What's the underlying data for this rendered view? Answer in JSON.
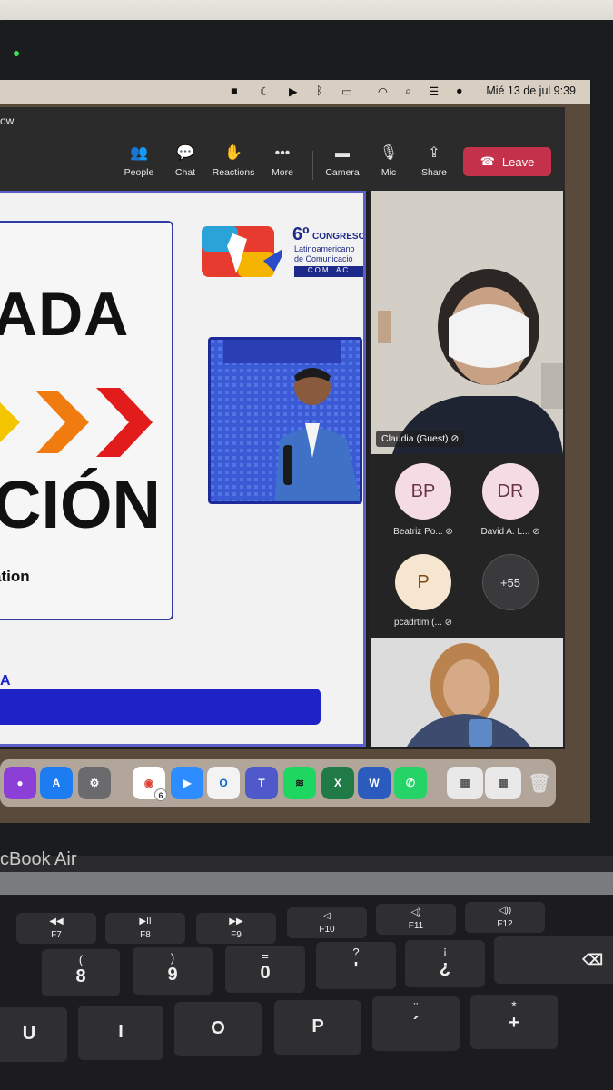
{
  "menubar": {
    "clock": "Mié 13 de jul  9:39"
  },
  "window": {
    "title": "ow"
  },
  "toolbar": {
    "people": "People",
    "chat": "Chat",
    "reactions": "Reactions",
    "more": "More",
    "camera": "Camera",
    "mic": "Mic",
    "share": "Share",
    "leave": "Leave"
  },
  "slide": {
    "line1": "ADA",
    "line2": "CIÓN",
    "line3": "ation",
    "footer_letter": "A",
    "logo_number": "6º",
    "logo_title": "CONGRESO",
    "logo_line2": "Latinoamericano",
    "logo_line3": "de Comunicació",
    "logo_badge": "COMLAC"
  },
  "participants": {
    "main_name": "Claudia (Guest)",
    "tiles": [
      {
        "initials": "BP",
        "name": "Beatriz Po..."
      },
      {
        "initials": "DR",
        "name": "David A. L..."
      },
      {
        "initials": "P",
        "name": "pcadrtim (..."
      },
      {
        "initials": "+55",
        "name": ""
      }
    ]
  },
  "dock": {
    "chrome_badge": "6"
  },
  "laptop": {
    "brand": "cBook Air"
  },
  "keyboard": {
    "row1": [
      {
        "top": "◀◀",
        "label": "F7"
      },
      {
        "top": "▶II",
        "label": "F8"
      },
      {
        "top": "▶▶",
        "label": "F9"
      },
      {
        "top": "◁",
        "label": "F10"
      },
      {
        "top": "◁)",
        "label": "F11"
      },
      {
        "top": "◁))",
        "label": "F12"
      }
    ],
    "row2": [
      {
        "top": "(",
        "label": "8"
      },
      {
        "top": ")",
        "label": "9"
      },
      {
        "top": "=",
        "label": "0"
      },
      {
        "top": "?",
        "label": "'"
      },
      {
        "top": "¡",
        "label": "¿"
      }
    ],
    "row3": [
      {
        "label": "U"
      },
      {
        "label": "I"
      },
      {
        "label": "O"
      },
      {
        "label": "P"
      },
      {
        "top": "¨",
        "label": "´"
      },
      {
        "top": "*",
        "label": "+"
      }
    ]
  },
  "colors": {
    "leave": "#c4314b",
    "accent": "#5b5fc7",
    "slide_blue": "#1e22c7"
  }
}
